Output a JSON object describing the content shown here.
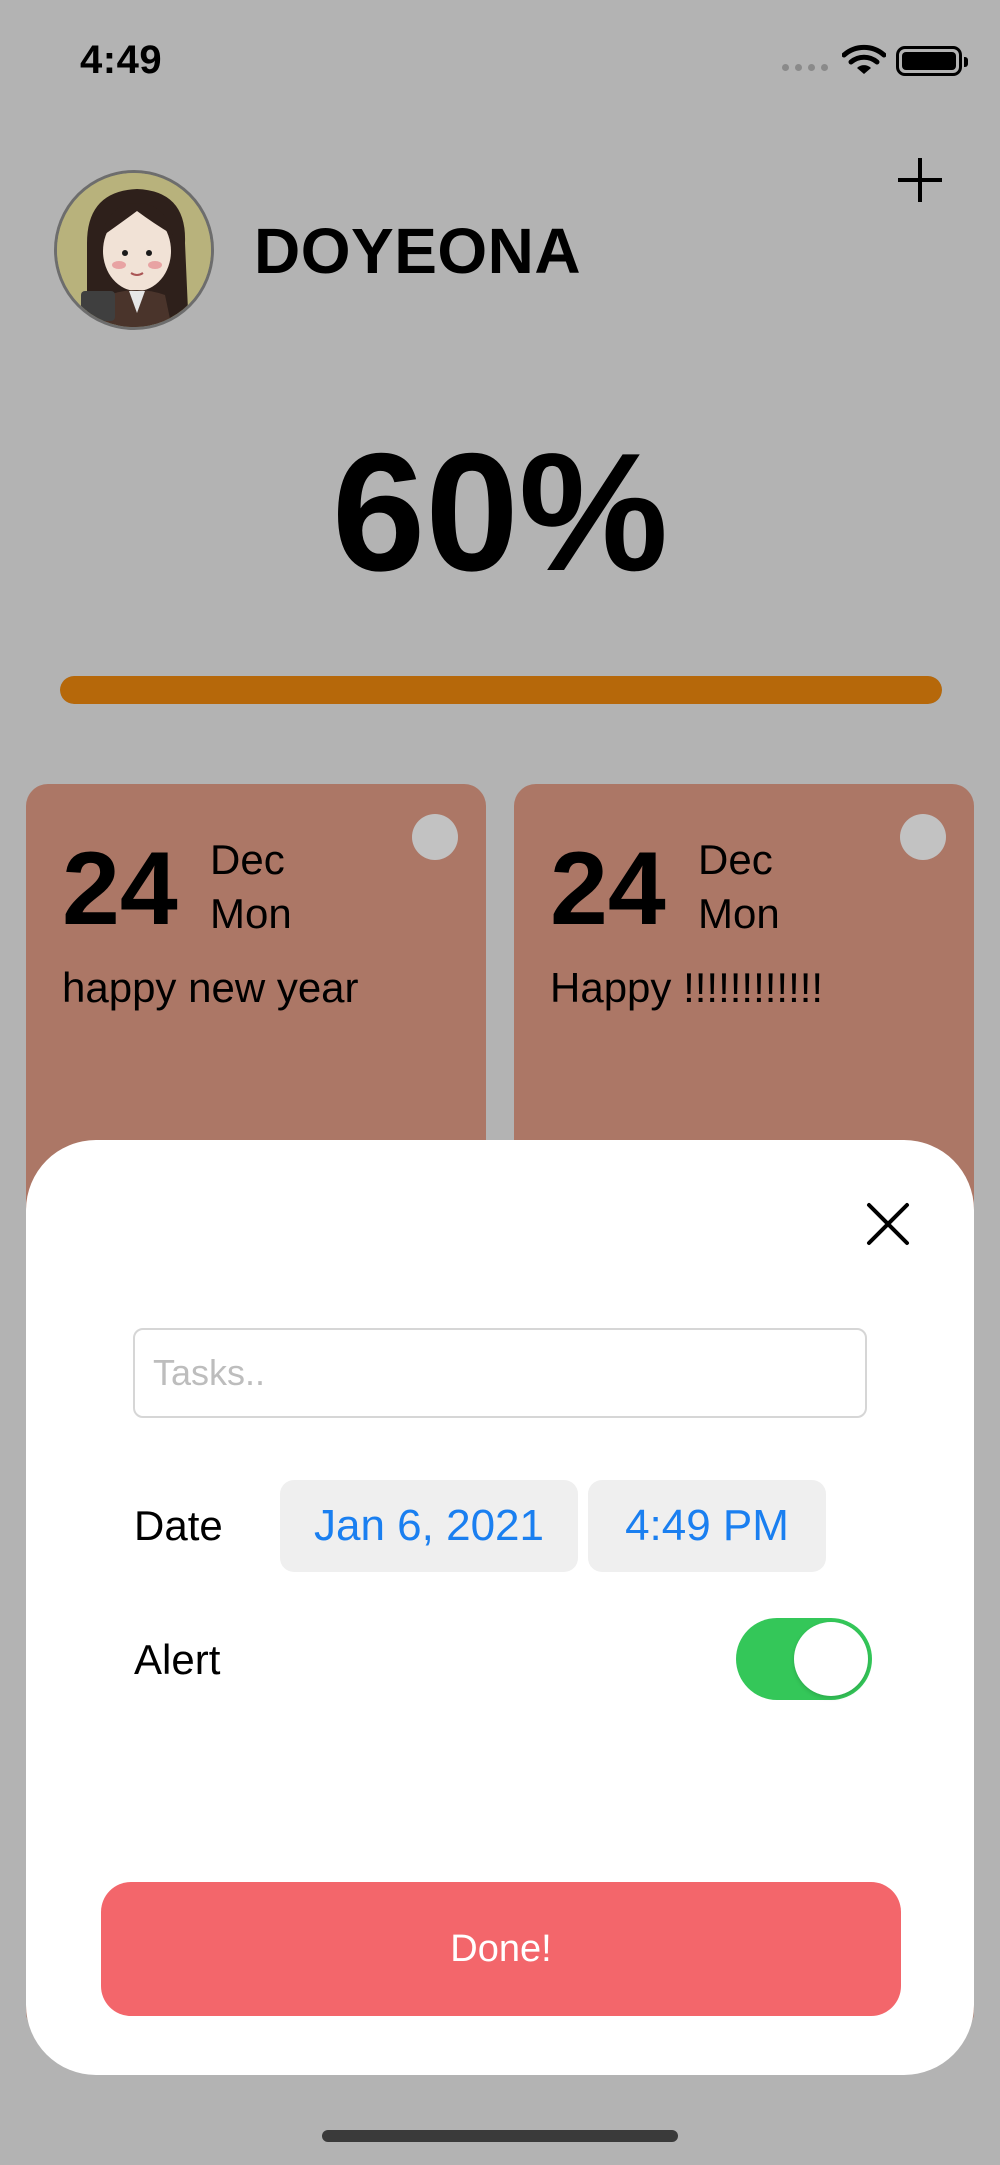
{
  "status_bar": {
    "time": "4:49",
    "icons": [
      "cellular-icon",
      "wifi-icon",
      "battery-icon"
    ]
  },
  "header": {
    "username": "DOYEONA",
    "add_icon": "plus-icon",
    "avatar_icon": "avatar"
  },
  "progress": {
    "percent_label": "60%",
    "value": 1.0,
    "color": "#b6680a"
  },
  "cards": [
    {
      "day": "24",
      "month": "Dec",
      "weekday": "Mon",
      "text": "happy new year"
    },
    {
      "day": "24",
      "month": "Dec",
      "weekday": "Mon",
      "text": "Happy !!!!!!!!!!!!"
    }
  ],
  "sheet": {
    "task_placeholder": "Tasks..",
    "task_value": "",
    "date_label": "Date",
    "date_value": "Jan 6, 2021",
    "time_value": "4:49 PM",
    "alert_label": "Alert",
    "alert_on": true,
    "done_label": "Done!",
    "accent_color": "#1a7ff0",
    "done_color": "#f3666b",
    "toggle_color": "#34c759"
  }
}
